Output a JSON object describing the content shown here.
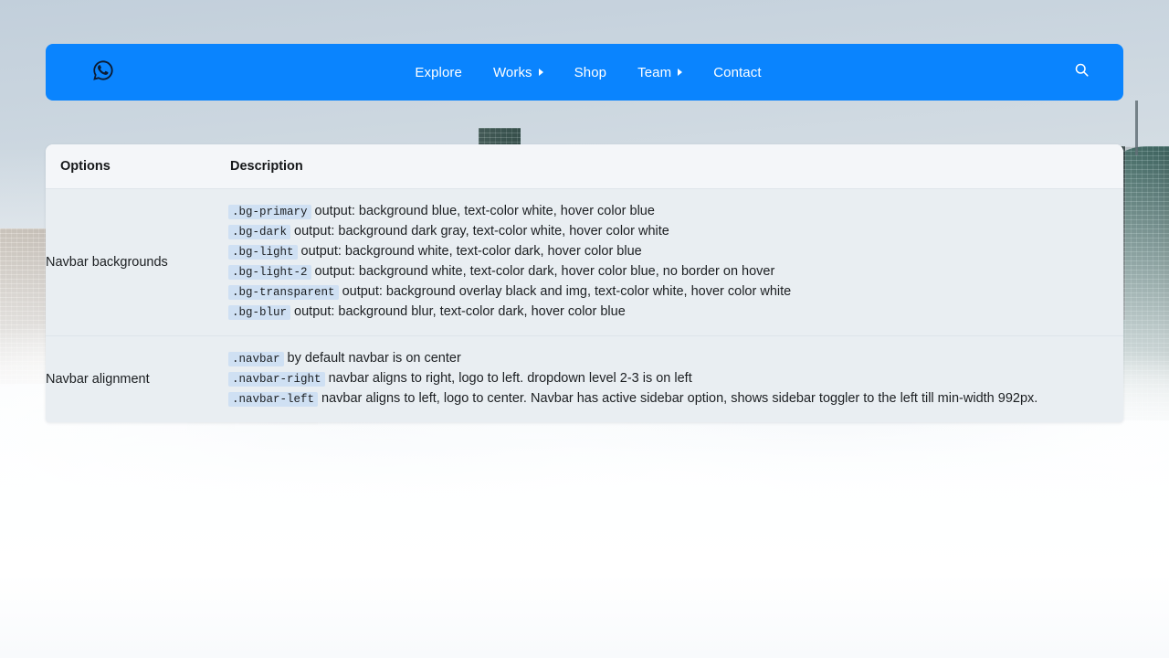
{
  "theme": {
    "navbar_blue": "#0a84fe",
    "chip_blue": "#cfe0f3",
    "panel_bg": "#e9eef2",
    "panel_header_bg": "#f4f6f9",
    "text_dark": "#1c1f22"
  },
  "navbar": {
    "logo_icon": "whatsapp-logo-icon",
    "links": [
      {
        "label": "Explore",
        "has_dropdown": false
      },
      {
        "label": "Works",
        "has_dropdown": true
      },
      {
        "label": "Shop",
        "has_dropdown": false
      },
      {
        "label": "Team",
        "has_dropdown": true
      },
      {
        "label": "Contact",
        "has_dropdown": false
      }
    ],
    "search_icon": "search-icon"
  },
  "table": {
    "headers": {
      "options": "Options",
      "description": "Description"
    },
    "rows": [
      {
        "option": "Navbar backgrounds",
        "lines": [
          {
            "code": ".bg-primary",
            "text": "output: background blue, text-color white, hover color blue"
          },
          {
            "code": ".bg-dark",
            "text": "output: background dark gray, text-color white, hover color white"
          },
          {
            "code": ".bg-light",
            "text": "output: background white, text-color dark, hover color blue"
          },
          {
            "code": ".bg-light-2",
            "text": "output: background white, text-color dark, hover color blue, no border on hover"
          },
          {
            "code": ".bg-transparent",
            "text": "output: background overlay black and img, text-color white, hover color white"
          },
          {
            "code": ".bg-blur",
            "text": "output: background blur, text-color dark, hover color blue"
          }
        ]
      },
      {
        "option": "Navbar alignment",
        "lines": [
          {
            "code": ".navbar",
            "text": "by default navbar is on center"
          },
          {
            "code": ".navbar-right",
            "text": "navbar aligns to right, logo to left. dropdown level 2-3 is on left"
          },
          {
            "code": ".navbar-left",
            "text": "navbar aligns to left, logo to center. Navbar has active sidebar option, shows sidebar toggler to the left till min-width 992px."
          }
        ]
      }
    ]
  }
}
